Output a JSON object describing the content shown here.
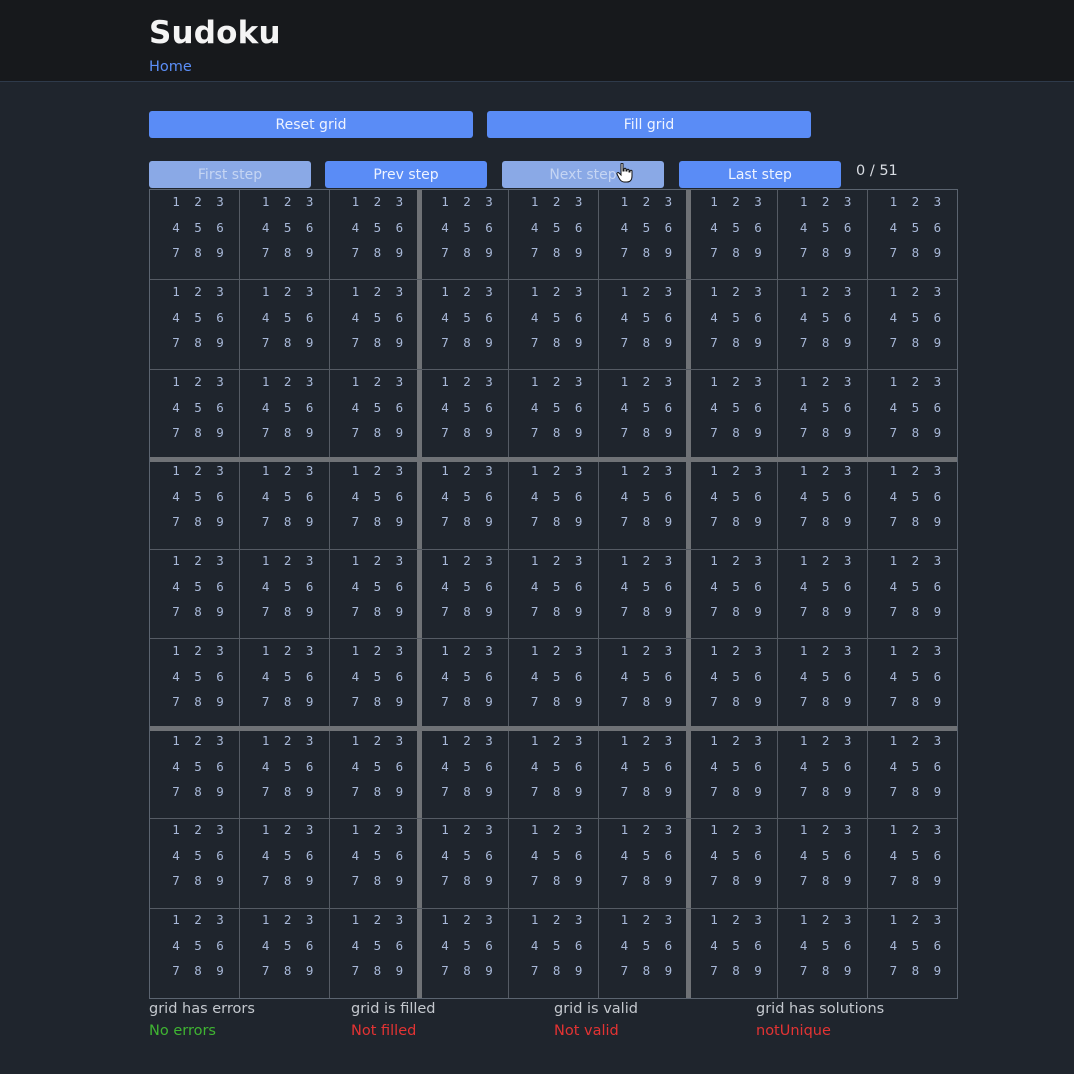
{
  "header": {
    "title": "Sudoku",
    "home_link": "Home"
  },
  "toolbar": {
    "reset_label": "Reset grid",
    "fill_label": "Fill grid"
  },
  "steps": {
    "first_label": "First step",
    "prev_label": "Prev step",
    "next_label": "Next step",
    "last_label": "Last step",
    "first_disabled": true,
    "next_disabled": true,
    "counter": "0 / 51"
  },
  "grid": {
    "rows": 9,
    "cols": 9,
    "candidates": [
      "1",
      "2",
      "3",
      "4",
      "5",
      "6",
      "7",
      "8",
      "9"
    ]
  },
  "status": {
    "errors": {
      "label": "grid has errors",
      "value": "No errors",
      "state": "ok"
    },
    "filled": {
      "label": "grid is filled",
      "value": "Not filled",
      "state": "bad"
    },
    "valid": {
      "label": "grid is valid",
      "value": "Not valid",
      "state": "bad"
    },
    "solutions": {
      "label": "grid has solutions",
      "value": "notUnique",
      "state": "bad"
    }
  },
  "colors": {
    "accent": "#5a8cf6",
    "ok": "#3fb432",
    "error": "#e33333"
  }
}
